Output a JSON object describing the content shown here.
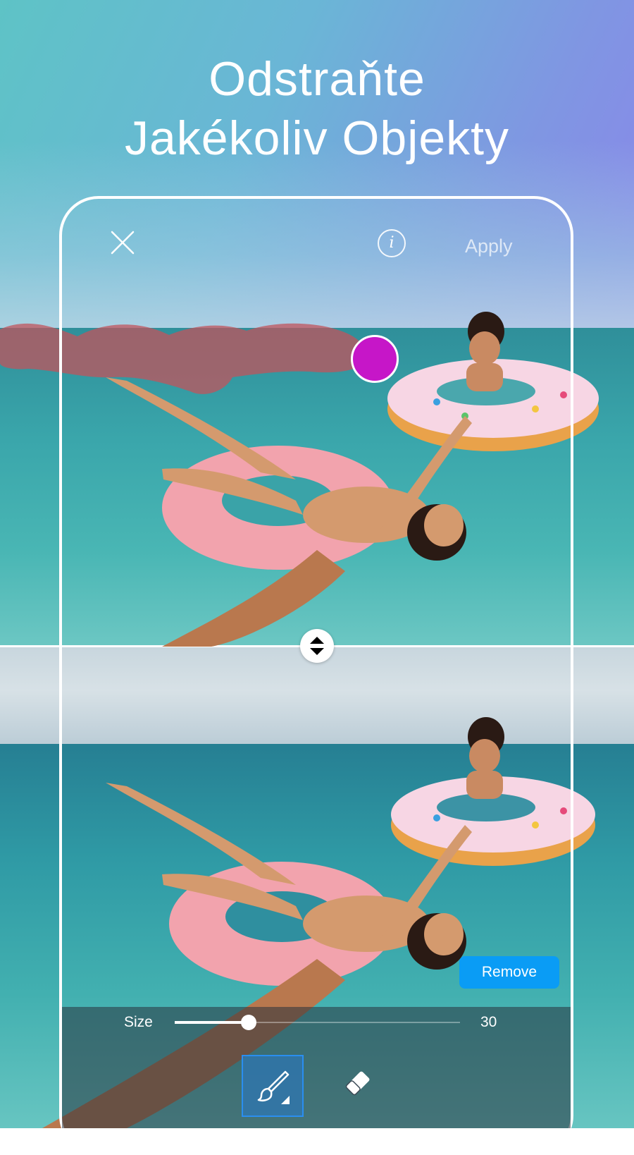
{
  "headline": {
    "line1": "Odstraňte",
    "line2": "Jakékoliv Objekty"
  },
  "toolbar": {
    "close_icon": "close-icon",
    "info_label": "i",
    "apply_label": "Apply"
  },
  "editor": {
    "brush_color": "#c616c8",
    "mask_color": "#c0545c",
    "remove_label": "Remove"
  },
  "controls": {
    "size_label": "Size",
    "size_value": "30",
    "size_fraction": 0.26,
    "tools": [
      {
        "name": "brush-icon",
        "selected": true
      },
      {
        "name": "eraser-icon",
        "selected": false
      }
    ],
    "accent": "#0a9cf5"
  }
}
